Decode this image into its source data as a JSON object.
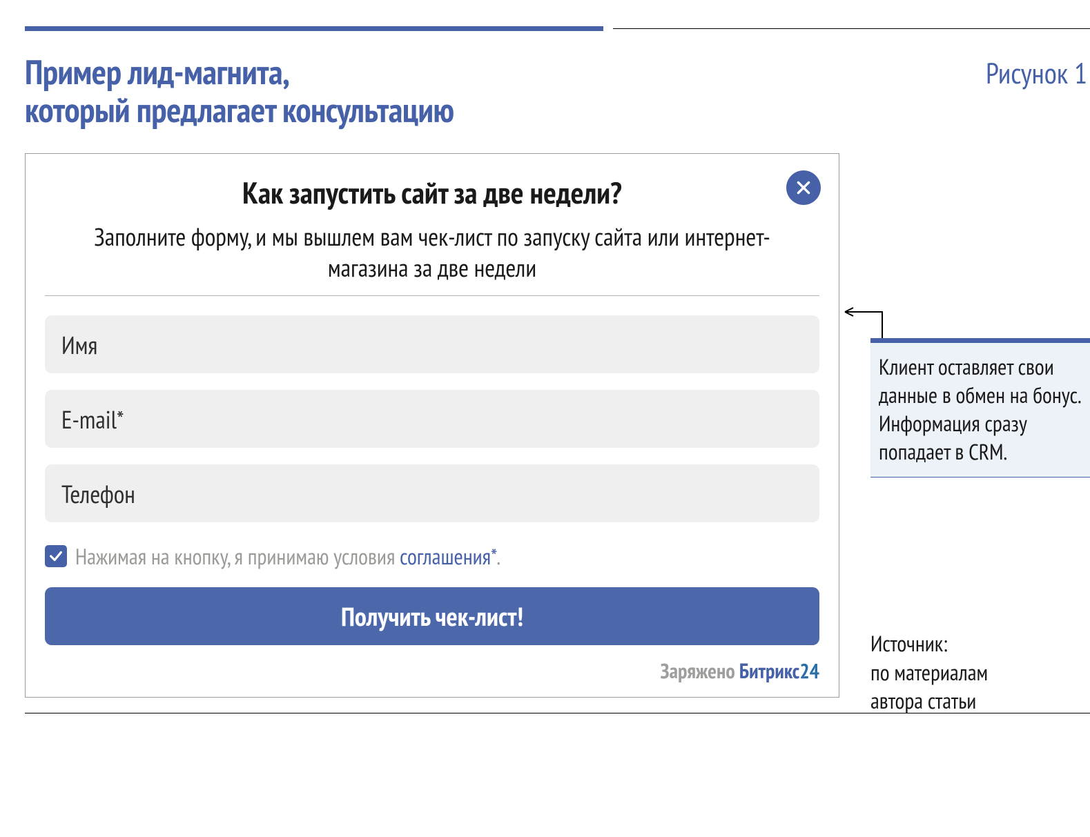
{
  "header": {
    "title_l1": "Пример лид-магнита,",
    "title_l2": "который предлагает консультацию",
    "figure_label": "Рисунок 1"
  },
  "card": {
    "title": "Как запустить сайт за две недели?",
    "subtitle": "Заполните форму, и мы вышлем вам чек-лист по запуску сайта или интернет-магазина за две недели",
    "field_name_placeholder": "Имя",
    "field_email_label": "E-mail",
    "field_email_required_mark": "*",
    "field_phone_placeholder": "Телефон",
    "consent_checked": true,
    "consent_text": "Нажимая на кнопку, я принимаю условия ",
    "consent_link": "соглашения",
    "consent_required_mark": "*",
    "consent_tail": ".",
    "submit_label": "Получить чек-лист!",
    "powered_prefix": "Заряжено ",
    "powered_brand": "Битрикс",
    "powered_suffix": "24"
  },
  "annotation": {
    "note": "Клиент оставляет свои данные в обмен на бонус. Информация сразу попадает в CRM.",
    "source_l1": "Источник:",
    "source_l2": "по материалам",
    "source_l3": "автора статьи"
  }
}
